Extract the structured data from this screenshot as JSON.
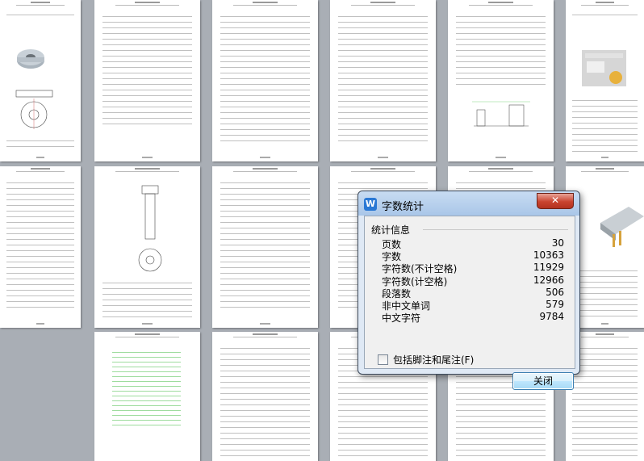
{
  "dialog": {
    "title": "字数统计",
    "app_icon": "W",
    "close_label": "✕",
    "group_label": "统计信息",
    "stats": [
      {
        "label": "页数",
        "value": "30"
      },
      {
        "label": "字数",
        "value": "10363"
      },
      {
        "label": "字符数(不计空格)",
        "value": "11929"
      },
      {
        "label": "字符数(计空格)",
        "value": "12966"
      },
      {
        "label": "段落数",
        "value": "506"
      },
      {
        "label": "非中文单词",
        "value": "579"
      },
      {
        "label": "中文字符",
        "value": "9784"
      }
    ],
    "include_footnotes_label": "包括脚注和尾注(F)",
    "include_footnotes_checked": false,
    "close_button_label": "关闭"
  }
}
